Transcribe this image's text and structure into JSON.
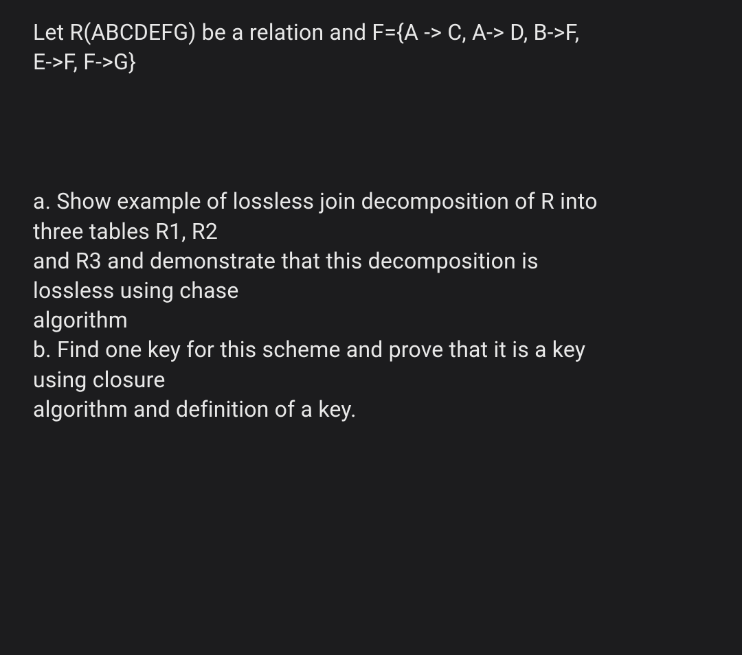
{
  "problem": {
    "given_line1": "Let R(ABCDEFG) be a relation and F={A -> C, A-> D, B->F,",
    "given_line2": "E->F, F->G}",
    "part_a_line1": "a. Show example of lossless join decomposition of R into",
    "part_a_line2": "three tables R1, R2",
    "part_a_line3": "and R3 and demonstrate that this decomposition is",
    "part_a_line4": "lossless using chase",
    "part_a_line5": "algorithm",
    "part_b_line1": "b. Find one key for this scheme and prove that it is a key",
    "part_b_line2": "using closure",
    "part_b_line3": "algorithm and definition of a key."
  }
}
